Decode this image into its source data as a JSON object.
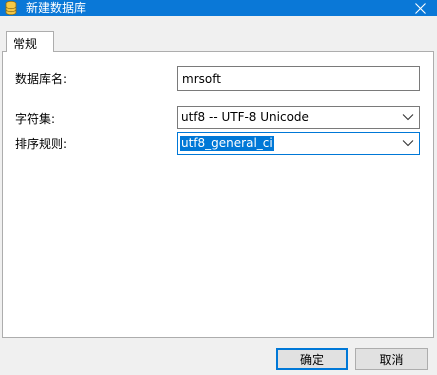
{
  "window": {
    "title": "新建数据库",
    "icon": "database-icon"
  },
  "tabs": [
    {
      "label": "常规"
    }
  ],
  "form": {
    "db_name": {
      "label": "数据库名:",
      "value": "mrsoft"
    },
    "charset": {
      "label": "字符集:",
      "value": "utf8 -- UTF-8 Unicode"
    },
    "collation": {
      "label": "排序规则:",
      "value": "utf8_general_ci"
    }
  },
  "buttons": {
    "ok": "确定",
    "cancel": "取消"
  },
  "colors": {
    "titlebar": "#0a78d7",
    "accent": "#0078d7"
  }
}
